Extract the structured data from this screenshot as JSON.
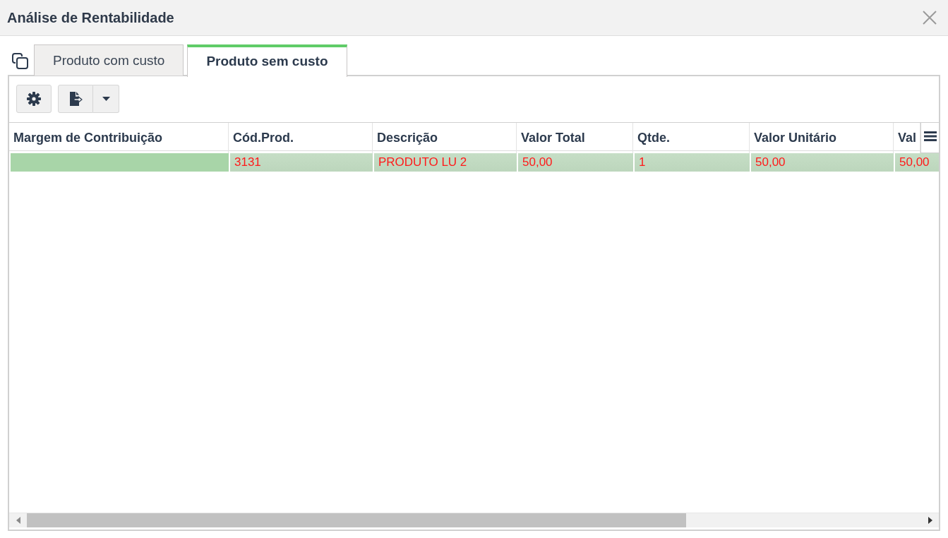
{
  "window": {
    "title": "Análise de Rentabilidade"
  },
  "tabs": [
    {
      "label": "Produto com custo",
      "selected": false
    },
    {
      "label": "Produto sem custo",
      "selected": true
    }
  ],
  "table": {
    "columns": [
      "Margem de Contribuição",
      "Cód.Prod.",
      "Descrição",
      "Valor Total",
      "Qtde.",
      "Valor Unitário",
      "Val"
    ],
    "rows": [
      {
        "selected": true,
        "color": "#a8d5a8",
        "cells": [
          "",
          "3131",
          "PRODUTO LU 2",
          "50,00",
          "1",
          "50,00",
          "50,00"
        ]
      }
    ]
  }
}
